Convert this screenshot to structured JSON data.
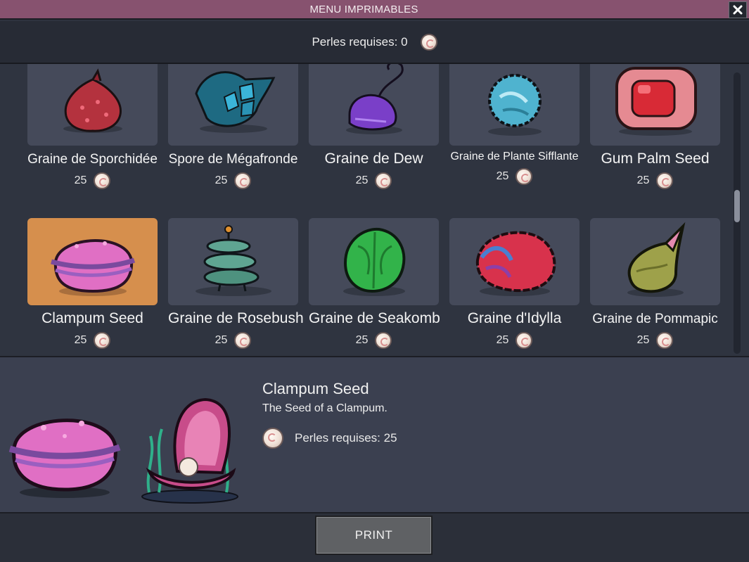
{
  "window": {
    "title": "MENU IMPRIMABLES",
    "close_icon": "close-icon"
  },
  "header": {
    "label": "Perles requises: 0",
    "icon": "pearl-icon"
  },
  "items": [
    {
      "name": "Graine de Sporchidée",
      "cost": "25",
      "icon": "red-bulb-seed-icon"
    },
    {
      "name": "Spore de Mégafronde",
      "cost": "25",
      "icon": "blue-crystal-spore-icon"
    },
    {
      "name": "Graine de Dew",
      "cost": "25",
      "icon": "purple-dew-seed-icon"
    },
    {
      "name": "Graine de Plante Sifflante",
      "cost": "25",
      "icon": "blue-fuzzy-seed-icon"
    },
    {
      "name": "Gum Palm Seed",
      "cost": "25",
      "icon": "red-cube-seed-icon"
    },
    {
      "name": "Clampum Seed",
      "cost": "25",
      "icon": "pink-clam-seed-icon",
      "selected": true
    },
    {
      "name": "Graine de Rosebush",
      "cost": "25",
      "icon": "green-stacked-seed-icon"
    },
    {
      "name": "Graine de Seakomb",
      "cost": "25",
      "icon": "green-sprout-seed-icon"
    },
    {
      "name": "Graine d'Idylla",
      "cost": "25",
      "icon": "red-coral-seed-icon"
    },
    {
      "name": "Graine de Pommapic",
      "cost": "25",
      "icon": "olive-horn-seed-icon"
    }
  ],
  "details": {
    "name": "Clampum Seed",
    "description": "The Seed of a Clampum.",
    "cost_label": "Perles requises: 25",
    "seed_icon": "pink-clam-seed-icon",
    "plant_icon": "clampum-plant-icon"
  },
  "footer": {
    "print_label": "PRINT"
  },
  "colors": {
    "title_bar": "#87526f",
    "tile": "#454a5a",
    "selected_tile": "#d68f4d",
    "details_bg": "#3b4050"
  }
}
